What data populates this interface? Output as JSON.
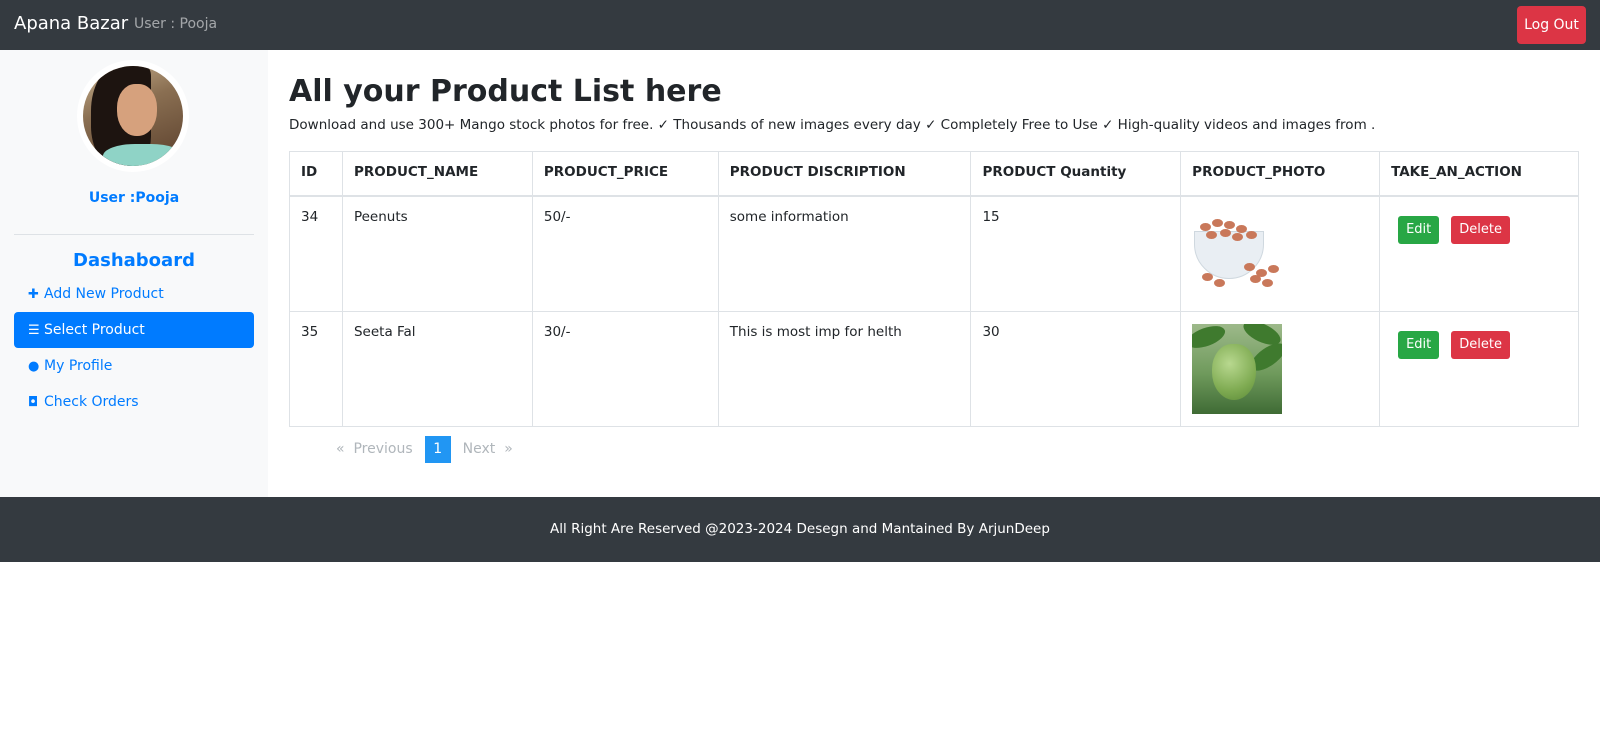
{
  "navbar": {
    "brand": "Apana Bazar",
    "user_text": "User : Pooja",
    "logout_label": "Log Out"
  },
  "sidebar": {
    "user_label": "User :Pooja",
    "heading": "Dashaboard",
    "items": [
      {
        "label": "Add New Product",
        "icon": "plus-icon",
        "active": false
      },
      {
        "label": "Select Product",
        "icon": "list-icon",
        "active": true
      },
      {
        "label": "My Profile",
        "icon": "user-icon",
        "active": false
      },
      {
        "label": "Check Orders",
        "icon": "shopping-bag-icon",
        "active": false
      }
    ]
  },
  "main": {
    "title": "All your Product List here",
    "description": "Download and use 300+ Mango stock photos for free. ✓ Thousands of new images every day ✓ Completely Free to Use ✓ High-quality videos and images from ."
  },
  "table": {
    "headers": [
      "ID",
      "PRODUCT_NAME",
      "PRODUCT_PRICE",
      "PRODUCT DISCRIPTION",
      "PRODUCT Quantity",
      "PRODUCT_PHOTO",
      "TAKE_AN_ACTION"
    ],
    "rows": [
      {
        "id": "34",
        "name": "Peenuts",
        "price": "50/-",
        "description": "some information",
        "quantity": "15",
        "photo": "peanuts-photo"
      },
      {
        "id": "35",
        "name": "Seeta Fal",
        "price": "30/-",
        "description": "This is most imp for helth",
        "quantity": "30",
        "photo": "custard-apple-photo"
      }
    ],
    "edit_label": "Edit",
    "delete_label": "Delete"
  },
  "pagination": {
    "prev_arrow": "«",
    "prev_label": "Previous",
    "current_page": "1",
    "next_label": "Next",
    "next_arrow": "»"
  },
  "footer": {
    "text": "All Right Are Reserved @2023-2024 Desegn and Mantained By ArjunDeep"
  },
  "colors": {
    "navbar": "#343a40",
    "primary": "#007bff",
    "danger": "#dc3545",
    "success": "#28a745",
    "page_active": "#2196f3"
  }
}
